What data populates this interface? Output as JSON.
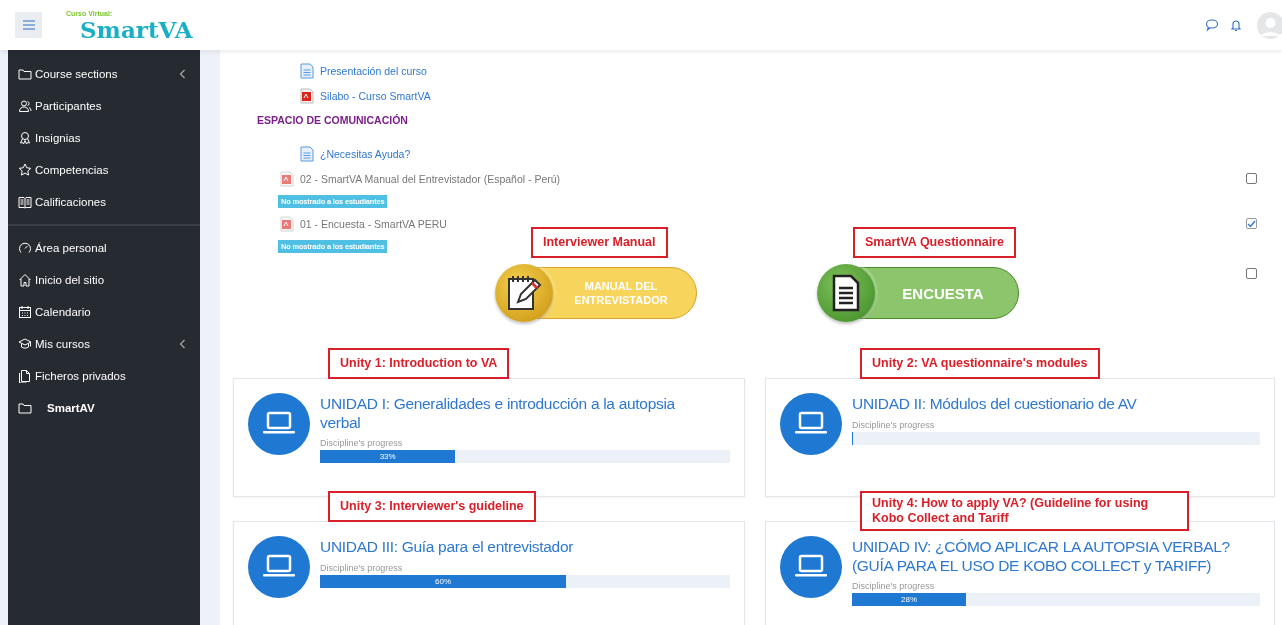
{
  "header": {
    "logo_caption": "Curso Virtual:",
    "logo": "SmartVA"
  },
  "sidebar": {
    "sections": [
      {
        "items": [
          {
            "kind": "folder",
            "label": "Course sections",
            "expandable": true
          },
          {
            "kind": "people",
            "label": "Participantes",
            "expandable": false
          },
          {
            "kind": "award",
            "label": "Insignias",
            "expandable": false
          },
          {
            "kind": "star",
            "label": "Competencias",
            "expandable": false
          },
          {
            "kind": "book",
            "label": "Calificaciones",
            "expandable": false
          }
        ]
      },
      {
        "items": [
          {
            "kind": "gauge",
            "label": "Área personal",
            "expandable": false
          },
          {
            "kind": "home",
            "label": "Inicio del sitio",
            "expandable": false
          },
          {
            "kind": "calendar",
            "label": "Calendario",
            "expandable": false
          },
          {
            "kind": "cap",
            "label": "Mis cursos",
            "expandable": true
          },
          {
            "kind": "files",
            "label": "Ficheros privados",
            "expandable": false
          },
          {
            "kind": "course",
            "label": "SmartAV",
            "expandable": false
          }
        ]
      }
    ]
  },
  "activities": [
    {
      "kind": "page",
      "title": "Presentación del curso",
      "hidden": false
    },
    {
      "kind": "pdf",
      "title": "Silabo - Curso SmartVA",
      "hidden": false
    },
    {
      "kind": "heading",
      "title": "ESPACIO DE COMUNICACIÓN"
    },
    {
      "kind": "page",
      "title": "¿Necesitas Ayuda?",
      "hidden": false
    },
    {
      "kind": "pdf",
      "title": "02 - SmartVA Manual del Entrevistador (Español - Perú)",
      "hidden": true,
      "badge": "No mostrado a los estudiantes",
      "checked": false
    },
    {
      "kind": "pdf",
      "title": "01 - Encuesta - SmartVA PERU",
      "hidden": true,
      "badge": "No mostrado a los estudiantes",
      "checked": true
    },
    {
      "kind": "buttons",
      "checked": false,
      "buttons": [
        {
          "kind": "manual",
          "label": "MANUAL DEL ENTREVISTADOR",
          "annotation": "Interviewer Manual"
        },
        {
          "kind": "survey",
          "label": "ENCUESTA",
          "annotation": "SmartVA Questionnaire"
        }
      ]
    }
  ],
  "units": [
    {
      "title": "UNIDAD I: Generalidades e introducción a la autopsia verbal",
      "progress_label": "Discipline's progress",
      "level": 0.33,
      "reading": "33%",
      "annotation": "Unity 1: Introduction to VA"
    },
    {
      "title": "UNIDAD II: Módulos del cuestionario de AV",
      "progress_label": "Discipline's progress",
      "level": 0,
      "annotation": "Unity 2: VA questionnaire's modules"
    },
    {
      "title": "UNIDAD III: Guía para el entrevistador",
      "progress_label": "Discipline's progress",
      "level": 0.6,
      "reading": "60%",
      "annotation": "Unity 3: Interviewer's guideline"
    },
    {
      "title": "UNIDAD IV: ¿CÓMO APLICAR LA AUTOPSIA VERBAL? (GUÍA PARA EL USO DE KOBO COLLECT y TARIFF)",
      "progress_label": "Discipline's progress",
      "level": 0.28,
      "reading": "28%",
      "annotation": "Unity 4: How to apply VA? (Guideline for using Kobo Collect and Tariff"
    }
  ]
}
